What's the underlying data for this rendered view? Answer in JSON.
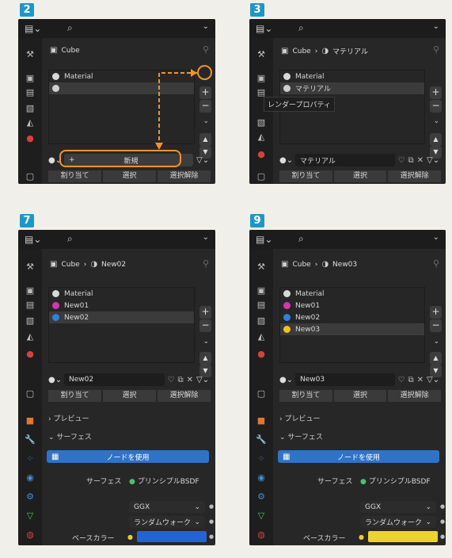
{
  "steps": [
    "2",
    "3",
    "7",
    "9"
  ],
  "common": {
    "search_icon": "search-icon",
    "toolbar_chevron": "⌄",
    "assign_label": "割り当て",
    "select_label": "選択",
    "deselect_label": "選択解除",
    "object_name": "Cube"
  },
  "panel2": {
    "crumb_object": "Cube",
    "slots": [
      "Material",
      ""
    ],
    "new_button_label": "新規"
  },
  "panel3": {
    "crumb_object": "Cube",
    "crumb_material": "マテリアル",
    "slots": [
      "Material",
      "マテリアル"
    ],
    "tooltip": "レンダープロパティ",
    "material_field": "マテリアル"
  },
  "panel7": {
    "crumb_object": "Cube",
    "crumb_material": "New02",
    "slots": [
      "Material",
      "New01",
      "New02"
    ],
    "slot_colors": [
      "#d8d8d8",
      "#d535b1",
      "#2a82e0"
    ],
    "material_field": "New02",
    "preview_header": "プレビュー",
    "surface_header": "サーフェス",
    "use_nodes_label": "ノードを使用",
    "surface_label": "サーフェス",
    "surface_value": "プリンシプルBSDF",
    "dist_value": "GGX",
    "sss_value": "ランダムウォーク",
    "base_color_label": "ベースカラー",
    "base_color": "#2463d6"
  },
  "panel9": {
    "crumb_object": "Cube",
    "crumb_material": "New03",
    "slots": [
      "Material",
      "New01",
      "New02",
      "New03"
    ],
    "slot_colors": [
      "#d8d8d8",
      "#d535b1",
      "#2a82e0",
      "#f0c419"
    ],
    "material_field": "New03",
    "preview_header": "プレビュー",
    "surface_header": "サーフェス",
    "use_nodes_label": "ノードを使用",
    "surface_label": "サーフェス",
    "surface_value": "プリンシプルBSDF",
    "dist_value": "GGX",
    "sss_value": "ランダムウォーク",
    "base_color_label": "ベースカラー",
    "base_color": "#ecd430"
  }
}
